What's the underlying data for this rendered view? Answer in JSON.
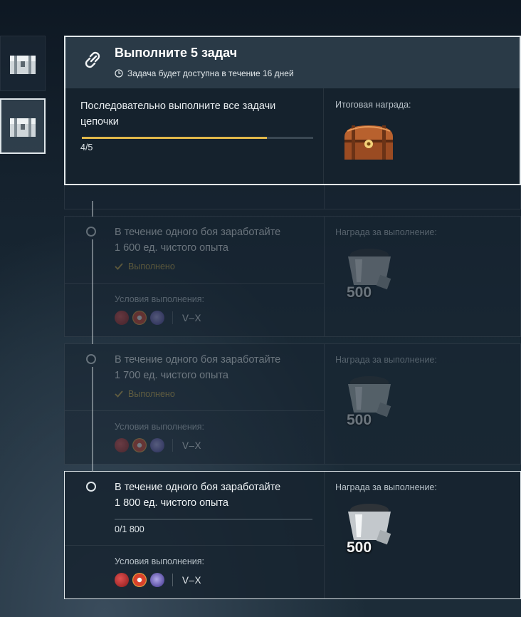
{
  "header": {
    "title": "Выполните 5 задач",
    "subtitle": "Задача будет доступна в течение 16 дней",
    "description": "Последовательно выполните все задачи цепочки",
    "progress_text": "4/5",
    "progress_fraction": 0.8,
    "final_reward_label": "Итоговая награда:"
  },
  "tasks": [
    {
      "title_line1": "В течение одного боя заработайте",
      "title_line2": "1 600 ед. чистого опыта",
      "status": "Выполнено",
      "conditions_label": "Условия выполнения:",
      "tier": "V–X",
      "reward_label": "Награда за выполнение:",
      "reward_amount": "500"
    },
    {
      "title_line1": "В течение одного боя заработайте",
      "title_line2": "1 700 ед. чистого опыта",
      "status": "Выполнено",
      "conditions_label": "Условия выполнения:",
      "tier": "V–X",
      "reward_label": "Награда за выполнение:",
      "reward_amount": "500"
    },
    {
      "title_line1": "В течение одного боя заработайте",
      "title_line2": "1 800 ед. чистого опыта",
      "progress_text": "0/1 800",
      "progress_fraction": 0,
      "conditions_label": "Условия выполнения:",
      "tier": "V–X",
      "reward_label": "Награда за выполнение:",
      "reward_amount": "500"
    }
  ],
  "colors": {
    "accent_progress": "#e0b84a",
    "done_text": "#c9a94a",
    "highlight_border": "#e3e9ec"
  },
  "icons": [
    "chest-icon",
    "link-icon",
    "clock-icon",
    "checkmark-icon",
    "coal-cart-icon",
    "treasure-chest-icon",
    "flag-icon"
  ]
}
